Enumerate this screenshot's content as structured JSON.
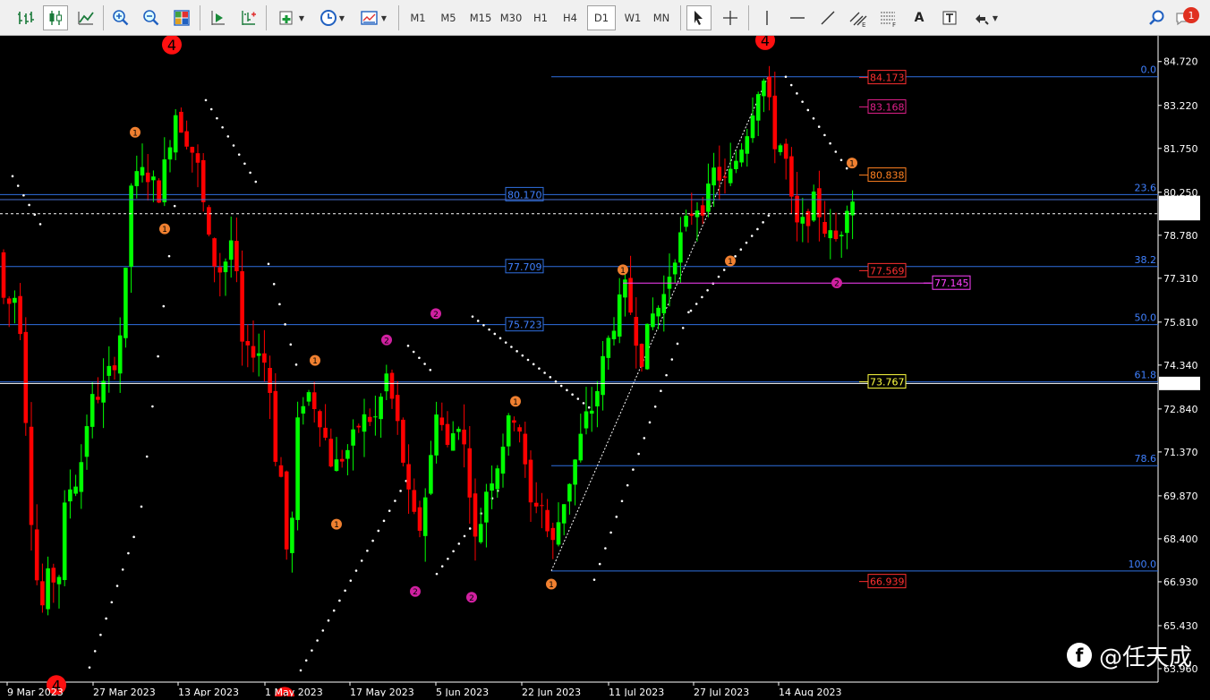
{
  "toolbar": {
    "timeframes": [
      "M1",
      "M5",
      "M15",
      "M30",
      "H1",
      "H4",
      "D1",
      "W1",
      "MN"
    ],
    "active_timeframe": "D1",
    "notification_count": "1"
  },
  "chart_data": {
    "type": "candlestick",
    "symbol_timeframe": "D1",
    "price_axis": [
      "84.720",
      "83.220",
      "81.750",
      "80.250",
      "78.780",
      "77.310",
      "75.810",
      "74.340",
      "72.840",
      "71.370",
      "69.870",
      "68.400",
      "66.930",
      "65.430",
      "63.960"
    ],
    "ylim": [
      63.5,
      85.6
    ],
    "current_bid": "79.903",
    "current_line": "79.518",
    "h_line_price": "73.713",
    "time_axis": [
      "9 Mar 2023",
      "27 Mar 2023",
      "13 Apr 2023",
      "1 May 2023",
      "17 May 2023",
      "5 Jun 2023",
      "22 Jun 2023",
      "11 Jul 2023",
      "27 Jul 2023",
      "14 Aug 2023"
    ],
    "fibonacci": {
      "levels": [
        {
          "label": "0.0",
          "price": 84.2
        },
        {
          "label": "23.6",
          "price": 80.17
        },
        {
          "label": "38.2",
          "price": 77.709
        },
        {
          "label": "50.0",
          "price": 75.723
        },
        {
          "label": "61.8",
          "price": 73.767
        },
        {
          "label": "78.6",
          "price": 70.9
        },
        {
          "label": "100.0",
          "price": 67.3
        }
      ],
      "left_tags": [
        "80.170",
        "77.709",
        "75.723"
      ]
    },
    "price_tags": [
      {
        "text": "84.173",
        "color": "#ff3030",
        "price": 84.173
      },
      {
        "text": "83.168",
        "color": "#e0208a",
        "price": 83.168
      },
      {
        "text": "80.838",
        "color": "#ff8020",
        "price": 80.838
      },
      {
        "text": "77.569",
        "color": "#ff3030",
        "price": 77.569
      },
      {
        "text": "77.145",
        "color": "#ff40ff",
        "price": 77.145
      },
      {
        "text": "73.767",
        "color": "#ffff40",
        "price": 73.767
      },
      {
        "text": "66.939",
        "color": "#ff3030",
        "price": 66.939
      }
    ],
    "markers": [
      {
        "label": "4",
        "kind": "big",
        "x": 192,
        "price": 85.3
      },
      {
        "label": "4",
        "kind": "big",
        "x": 855,
        "price": 85.45
      },
      {
        "label": "4",
        "kind": "big",
        "x": 63,
        "price": 63.4
      },
      {
        "label": "4",
        "kind": "big",
        "x": 318,
        "price": 63.0
      },
      {
        "label": "1",
        "kind": "small1",
        "x": 151,
        "price": 82.3
      },
      {
        "label": "1",
        "kind": "small1",
        "x": 184,
        "price": 79.0
      },
      {
        "label": "1",
        "kind": "small1",
        "x": 352,
        "price": 74.5
      },
      {
        "label": "1",
        "kind": "small1",
        "x": 376,
        "price": 68.9
      },
      {
        "label": "1",
        "kind": "small1",
        "x": 576,
        "price": 73.1
      },
      {
        "label": "1",
        "kind": "small1",
        "x": 616,
        "price": 66.85
      },
      {
        "label": "1",
        "kind": "small1",
        "x": 696,
        "price": 77.6
      },
      {
        "label": "1",
        "kind": "small1",
        "x": 816,
        "price": 77.9
      },
      {
        "label": "1",
        "kind": "small1",
        "x": 952,
        "price": 81.25
      },
      {
        "label": "2",
        "kind": "small2",
        "x": 432,
        "price": 75.2
      },
      {
        "label": "2",
        "kind": "small2",
        "x": 487,
        "price": 76.1
      },
      {
        "label": "2",
        "kind": "small2",
        "x": 464,
        "price": 66.6
      },
      {
        "label": "2",
        "kind": "small2",
        "x": 527,
        "price": 66.4
      },
      {
        "label": "2",
        "kind": "small2",
        "x": 935,
        "price": 77.15
      }
    ]
  },
  "watermark": {
    "logo": "f",
    "text": "@任天成"
  }
}
